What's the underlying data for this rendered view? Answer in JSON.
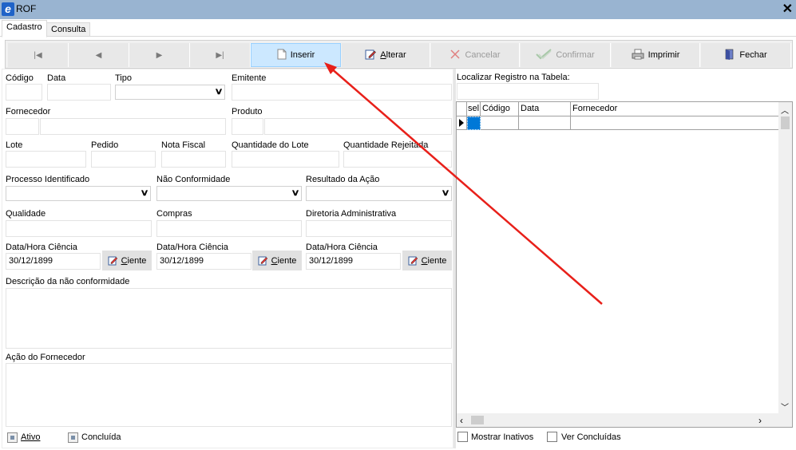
{
  "window": {
    "title": "ROF",
    "close_glyph": "✕",
    "app_icon_letter": "e"
  },
  "tabs": [
    {
      "label": "Cadastro",
      "active": true
    },
    {
      "label": "Consulta",
      "active": false
    }
  ],
  "toolbar": {
    "nav": [
      "|◀",
      "◀",
      "▶",
      "▶|"
    ],
    "inserir": "Inserir",
    "alterar_prefix": "A",
    "alterar_rest": "lterar",
    "cancelar": "Cancelar",
    "confirmar": "Confirmar",
    "imprimir": "Imprimir",
    "fechar": "Fechar"
  },
  "form": {
    "codigo": {
      "label": "Código",
      "value": ""
    },
    "data": {
      "label": "Data",
      "value": ""
    },
    "tipo": {
      "label": "Tipo",
      "value": ""
    },
    "emitente": {
      "label": "Emitente",
      "value": ""
    },
    "fornecedor": {
      "label": "Fornecedor",
      "value": ""
    },
    "produto": {
      "label": "Produto",
      "value": ""
    },
    "lote": {
      "label": "Lote",
      "value": ""
    },
    "pedido": {
      "label": "Pedido",
      "value": ""
    },
    "nota_fiscal": {
      "label": "Nota Fiscal",
      "value": ""
    },
    "quantidade_lote": {
      "label": "Quantidade do Lote",
      "value": ""
    },
    "quantidade_rejeitada": {
      "label": "Quantidade Rejeitada",
      "value": ""
    },
    "processo_identificado": {
      "label": "Processo Identificado",
      "value": ""
    },
    "nao_conformidade": {
      "label": "Não Conformidade",
      "value": ""
    },
    "resultado_acao": {
      "label": "Resultado da Ação",
      "value": ""
    },
    "qualidade": {
      "label": "Qualidade",
      "value": ""
    },
    "compras": {
      "label": "Compras",
      "value": ""
    },
    "diretoria": {
      "label": "Diretoria Administrativa",
      "value": ""
    },
    "ciencia_1": {
      "label": "Data/Hora Ciência",
      "value": "30/12/1899"
    },
    "ciencia_2": {
      "label": "Data/Hora Ciência",
      "value": "30/12/1899"
    },
    "ciencia_3": {
      "label": "Data/Hora Ciência",
      "value": "30/12/1899"
    },
    "ciente_prefix": "C",
    "ciente_rest": "iente",
    "descricao": {
      "label": "Descrição da não conformidade",
      "value": ""
    },
    "acao_fornecedor": {
      "label": "Ação do Fornecedor",
      "value": ""
    },
    "ativo": "Ativo",
    "concluida": "Concluída"
  },
  "right": {
    "localizar_label": "Localizar Registro na Tabela:",
    "localizar_value": "",
    "columns": [
      "sel",
      "Código",
      "Data",
      "Fornecedor"
    ],
    "mostrar_inativos": "Mostrar Inativos",
    "ver_concluidas": "Ver Concluídas"
  },
  "colors": {
    "titlebar": "#99b4d1",
    "highlight_button": "#cce8ff",
    "annotation_arrow": "#e8201a"
  }
}
